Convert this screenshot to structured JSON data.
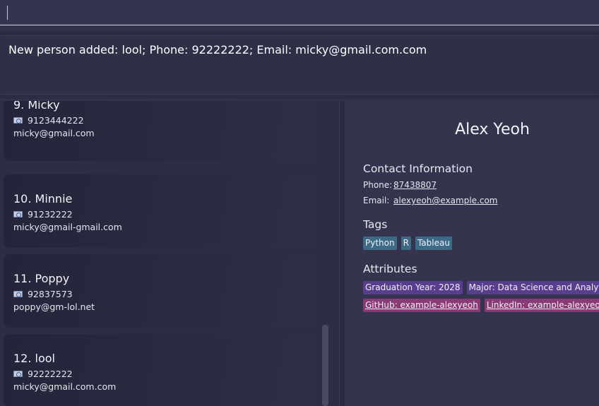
{
  "command_box": {
    "value": "",
    "placeholder": ""
  },
  "result_display": {
    "text": "New person added: lool; Phone: 92222222; Email: micky@gmail.com.com"
  },
  "person_list": [
    {
      "name": "9. Micky",
      "phone": "9123444222",
      "email": "micky@gmail.com"
    },
    {
      "name": "10. Minnie",
      "phone": "91232222",
      "email": "micky@gmail-gmail.com"
    },
    {
      "name": "11. Poppy",
      "phone": "92837573",
      "email": "poppy@gm-lol.net"
    },
    {
      "name": "12. lool",
      "phone": "92222222",
      "email": "micky@gmail.com.com"
    }
  ],
  "detail": {
    "name": "Alex Yeoh",
    "contact_title": "Contact Information",
    "phone_label": "Phone:",
    "phone": "87438807",
    "email_label": "Email:",
    "email": "alexyeoh@example.com",
    "tags_title": "Tags",
    "tags": [
      "Python",
      "R",
      "Tableau"
    ],
    "attributes_title": "Attributes",
    "attributes": [
      "Graduation Year: 2028",
      "Major: Data Science and Analytics"
    ],
    "links": [
      "GitHub: example-alexyeoh",
      "LinkedIn: example-alexyeoh"
    ]
  },
  "colors": {
    "background": "#323249",
    "tag_chip": "#3d6a86",
    "attribute_chip": "#5a3e8e",
    "link_chip": "#8a3a76"
  },
  "icons": {
    "phone": "phone-icon"
  }
}
